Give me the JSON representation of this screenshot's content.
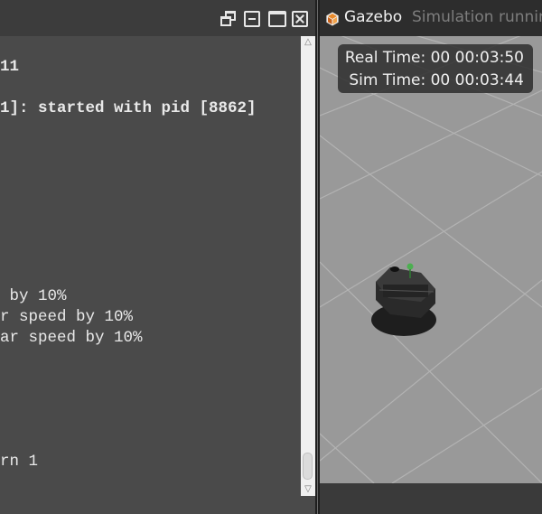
{
  "terminal": {
    "lines": [
      {
        "text": "11",
        "bold": true
      },
      {
        "text": "1]: started with pid [8862]",
        "bold": true
      },
      {
        "text": " by 10%",
        "bold": false
      },
      {
        "text": "r speed by 10%",
        "bold": false
      },
      {
        "text": "ar speed by 10%",
        "bold": false
      },
      {
        "text": "rn 1",
        "bold": false
      }
    ],
    "scroll_up_icon": "triangle-up",
    "scroll_down_icon": "triangle-down"
  },
  "gazebo": {
    "title": "Gazebo",
    "status": "Simulation running",
    "real_time_label": "Real Time:",
    "real_time_value": "00 00:03:50",
    "sim_time_label": "Sim Time:",
    "sim_time_value": "00 00:03:44",
    "ground_color": "#999999",
    "grid_color": "#b8b8b8"
  }
}
